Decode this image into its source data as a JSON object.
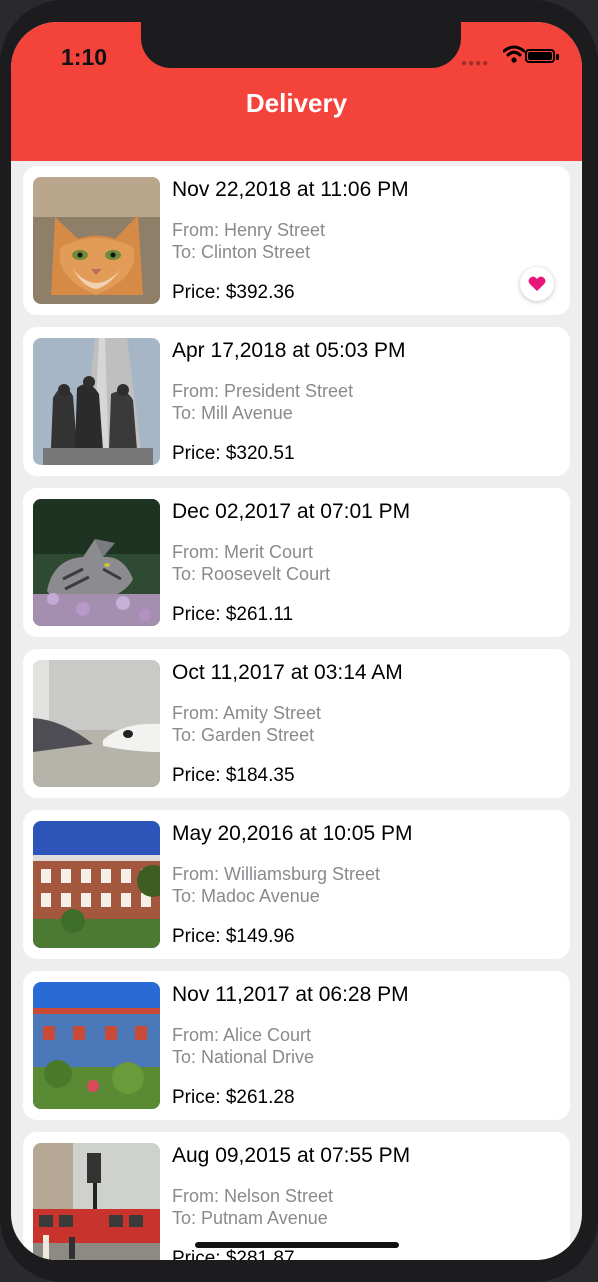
{
  "status_bar": {
    "time": "1:10"
  },
  "nav": {
    "title": "Delivery"
  },
  "colors": {
    "header": "#f3433b",
    "favorite": "#e8157a"
  },
  "deliveries": [
    {
      "date": "Nov 22,2018 at 11:06 PM",
      "from": "From: Henry Street",
      "to": "To: Clinton Street",
      "price": "Price: $392.36",
      "favorite": true,
      "image": "orange-cat"
    },
    {
      "date": "Apr 17,2018 at 05:03 PM",
      "from": "From: President Street",
      "to": "To: Mill Avenue",
      "price": "Price: $320.51",
      "favorite": false,
      "image": "statue"
    },
    {
      "date": "Dec 02,2017 at 07:01 PM",
      "from": "From: Merit Court",
      "to": "To: Roosevelt Court",
      "price": "Price: $261.11",
      "favorite": false,
      "image": "tabby-cat"
    },
    {
      "date": "Oct 11,2017 at 03:14 AM",
      "from": "From: Amity Street",
      "to": "To: Garden Street",
      "price": "Price: $184.35",
      "favorite": false,
      "image": "sleeping-cat"
    },
    {
      "date": "May 20,2016 at 10:05 PM",
      "from": "From: Williamsburg Street",
      "to": "To: Madoc Avenue",
      "price": "Price: $149.96",
      "favorite": false,
      "image": "brick-house"
    },
    {
      "date": "Nov 11,2017 at 06:28 PM",
      "from": "From: Alice Court",
      "to": "To: National Drive",
      "price": "Price: $261.28",
      "favorite": false,
      "image": "blue-house"
    },
    {
      "date": "Aug 09,2015 at 07:55 PM",
      "from": "From: Nelson Street",
      "to": "To: Putnam Avenue",
      "price": "Price: $281.87",
      "favorite": false,
      "image": "tram-street"
    }
  ]
}
